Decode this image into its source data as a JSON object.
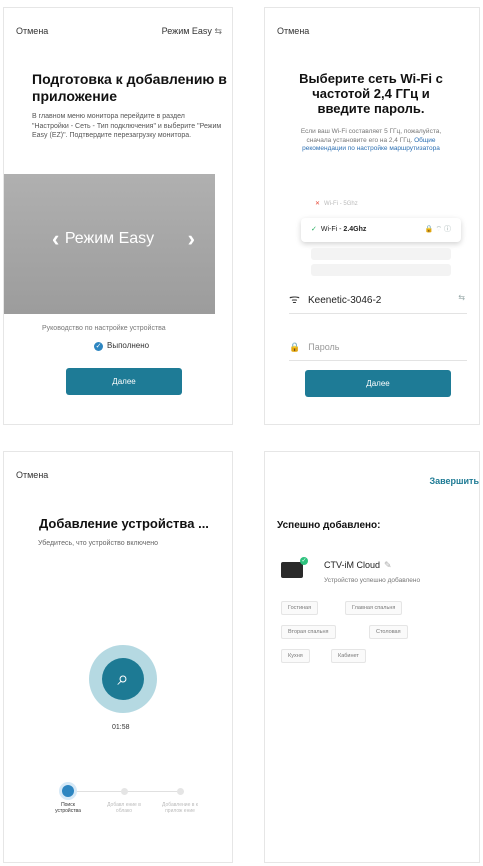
{
  "panel1": {
    "cancel": "Отмена",
    "mode": "Режим Easy",
    "mode_icon": "⇆",
    "title": "Подготовка к добавлению в приложение",
    "description": "В главном меню монитора перейдите в раздел \"Настройки - Сеть - Тип подключения\" и выберите \"Режим Easy (EZ)\". Подтвердите перезагрузку монитора.",
    "carousel_text": "Режим Easy",
    "guide": "Руководство по настройке устройства",
    "done": "Выполнено",
    "next": "Далее"
  },
  "panel2": {
    "cancel": "Отмена",
    "title": "Выберите сеть Wi-Fi с частотой 2,4 ГГц и введите пароль.",
    "description": "Если ваш Wi-Fi составляет 5 ГГц, пожалуйста, сначала установите его на 2,4 ГГц.",
    "description_link": "Общие рекомендации по настройке маршрутизатора",
    "faint_wifi": "Wi-Fi - 5Ghz",
    "wifi_prefix": "Wi-Fi - ",
    "wifi_bold": "2.4Ghz",
    "ssid": "Keenetic-3046-2",
    "password_placeholder": "Пароль",
    "next": "Далее"
  },
  "panel3": {
    "cancel": "Отмена",
    "title": "Добавление устройства ...",
    "subtitle": "Убедитесь, что устройство включено",
    "timer": "01:58",
    "steps": [
      "Поиск устройства",
      "Добавл ение в облако",
      "Добавление в к прилож ение"
    ]
  },
  "panel4": {
    "finish": "Завершить",
    "title": "Успешно добавлено:",
    "device_name": "CTV-iM Cloud",
    "device_status": "Устройство успешно добавлено",
    "rooms": [
      "Гостиная",
      "Главная спальня",
      "Вторая спальня",
      "Столовая",
      "Кухня",
      "Кабинет"
    ]
  }
}
